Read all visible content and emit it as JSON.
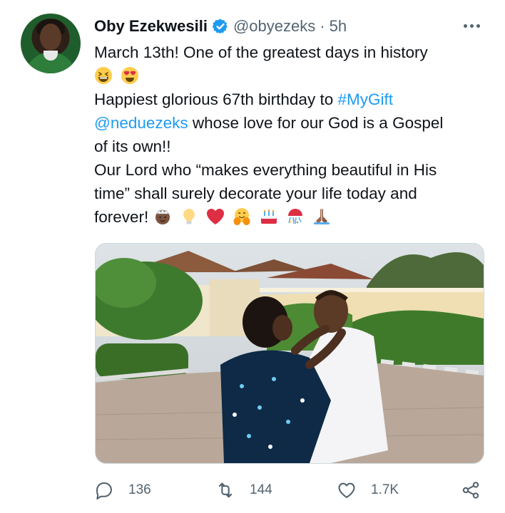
{
  "tweet": {
    "author_name": "Oby Ezekwesili",
    "handle": "@obyezeks",
    "separator": "·",
    "time": "5h",
    "lines": {
      "l1": "March 13th! One of the greatest days in history",
      "l3a": "Happiest glorious 67th birthday to ",
      "l3b": "#MyGift",
      "l4a": "@neduezeks",
      "l4b": " whose love for our God is a Gospel",
      "l5": "of its own!!",
      "l6": "Our Lord who “makes everything beautiful in His",
      "l7": "time” shall surely decorate your life today and",
      "l8": "forever!"
    },
    "emojis_line2": [
      "grinning-squinting-face",
      "heart-eyes-face"
    ],
    "emojis_line8": [
      "man-with-crown",
      "light-bulb",
      "red-heart",
      "hugging-face",
      "birthday-cake",
      "confetti-ball",
      "folded-hands"
    ]
  },
  "actions": {
    "reply_count": "136",
    "retweet_count": "144",
    "like_count": "1.7K"
  },
  "colors": {
    "link": "#1d9bf0",
    "verified": "#1d9bf0",
    "muted": "#536471"
  }
}
